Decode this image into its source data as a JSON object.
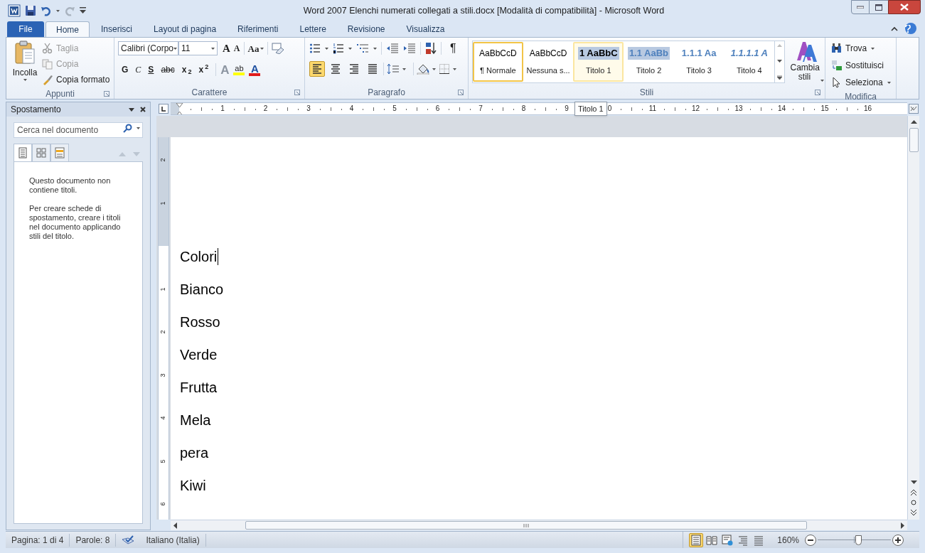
{
  "window": {
    "title": "Word 2007 Elenchi numerati collegati a stili.docx [Modalità di compatibilità]  -  Microsoft Word"
  },
  "tabs": [
    {
      "label": "File",
      "kind": "file",
      "selected": false
    },
    {
      "label": "Home",
      "kind": "tab",
      "selected": true
    },
    {
      "label": "Inserisci",
      "kind": "tab",
      "selected": false
    },
    {
      "label": "Layout di pagina",
      "kind": "tab",
      "selected": false
    },
    {
      "label": "Riferimenti",
      "kind": "tab",
      "selected": false
    },
    {
      "label": "Lettere",
      "kind": "tab",
      "selected": false
    },
    {
      "label": "Revisione",
      "kind": "tab",
      "selected": false
    },
    {
      "label": "Visualizza",
      "kind": "tab",
      "selected": false
    }
  ],
  "clipboard": {
    "label": "Appunti",
    "paste": "Incolla",
    "items": [
      {
        "kind": "cut",
        "label": "Taglia",
        "disabled": true
      },
      {
        "kind": "copy",
        "label": "Copia",
        "disabled": true
      },
      {
        "kind": "brush",
        "label": "Copia formato",
        "disabled": false
      }
    ]
  },
  "font": {
    "label": "Carattere",
    "family": "Calibri (Corpo",
    "size": "11",
    "grow": "A",
    "shrink": "A",
    "case": "Aa",
    "formats": [
      "G",
      "C",
      "S",
      "abc",
      "x$_{2}$",
      "x$^{2}$"
    ],
    "effects": "A",
    "highlight": "ab",
    "color_letter": "A"
  },
  "paragraph": {
    "label": "Paragrafo",
    "pilcrow": "¶",
    "alignments": [
      {
        "kind": "left",
        "selected": true
      },
      {
        "kind": "center",
        "selected": false
      },
      {
        "kind": "right",
        "selected": false
      },
      {
        "kind": "justify",
        "selected": false
      }
    ]
  },
  "styles": {
    "label": "Stili",
    "change": "Cambia stili",
    "items": [
      {
        "kind": "normal",
        "preview": "AaBbCcD",
        "label": "¶ Normale",
        "selected": true,
        "hovered": false
      },
      {
        "kind": "normal",
        "preview": "AaBbCcD",
        "label": "Nessuna s...",
        "selected": false,
        "hovered": false
      },
      {
        "kind": "h1",
        "preview": "1  AaBbC",
        "label": "Titolo 1",
        "selected": false,
        "hovered": true
      },
      {
        "kind": "h2",
        "preview": "1.1  AaBb",
        "label": "Titolo 2",
        "selected": false,
        "hovered": false
      },
      {
        "kind": "h3",
        "preview": "1.1.1  Aa",
        "label": "Titolo 3",
        "selected": false,
        "hovered": false
      },
      {
        "kind": "h4",
        "preview": "1.1.1.1  A",
        "label": "Titolo 4",
        "selected": false,
        "hovered": false
      }
    ]
  },
  "editing": {
    "label": "Modifica",
    "items": [
      {
        "kind": "find",
        "label": "Trova",
        "dropdown": true
      },
      {
        "kind": "replace",
        "label": "Sostituisci",
        "dropdown": false
      },
      {
        "kind": "select",
        "label": "Seleziona",
        "dropdown": true
      }
    ]
  },
  "tooltip": "Titolo 1",
  "navigation": {
    "title": "Spostamento",
    "placeholder": "Cerca nel documento",
    "tabs": [
      {
        "kind": "headings",
        "selected": true
      },
      {
        "kind": "pages",
        "selected": false
      },
      {
        "kind": "results",
        "selected": false
      }
    ],
    "messages": [
      "Questo documento non contiene titoli.",
      "Per creare schede di spostamento, creare i titoli nel documento applicando stili del titolo."
    ]
  },
  "ruler": {
    "horizontal": [
      "1",
      "2",
      "3",
      "4",
      "5",
      "6",
      "7",
      "8",
      "9",
      "0",
      "11",
      "12",
      "13",
      "14",
      "15",
      "16"
    ],
    "vertical": [
      "2",
      "1",
      "1",
      "2",
      "3",
      "4",
      "5",
      "6"
    ]
  },
  "document": {
    "paragraphs": [
      "Colori",
      "Bianco",
      "Rosso",
      "Verde",
      "Frutta",
      "Mela",
      "pera",
      "Kiwi"
    ]
  },
  "status_bar": {
    "page": "Pagina: 1 di 4",
    "words": "Parole: 8",
    "language": "Italiano (Italia)",
    "views": [
      {
        "kind": "print",
        "selected": true
      },
      {
        "kind": "reading",
        "selected": false
      },
      {
        "kind": "web",
        "selected": false
      },
      {
        "kind": "outline",
        "selected": false
      },
      {
        "kind": "draft",
        "selected": false
      }
    ],
    "zoom": "160%",
    "zoom_slider": {
      "level": 0.55
    }
  }
}
